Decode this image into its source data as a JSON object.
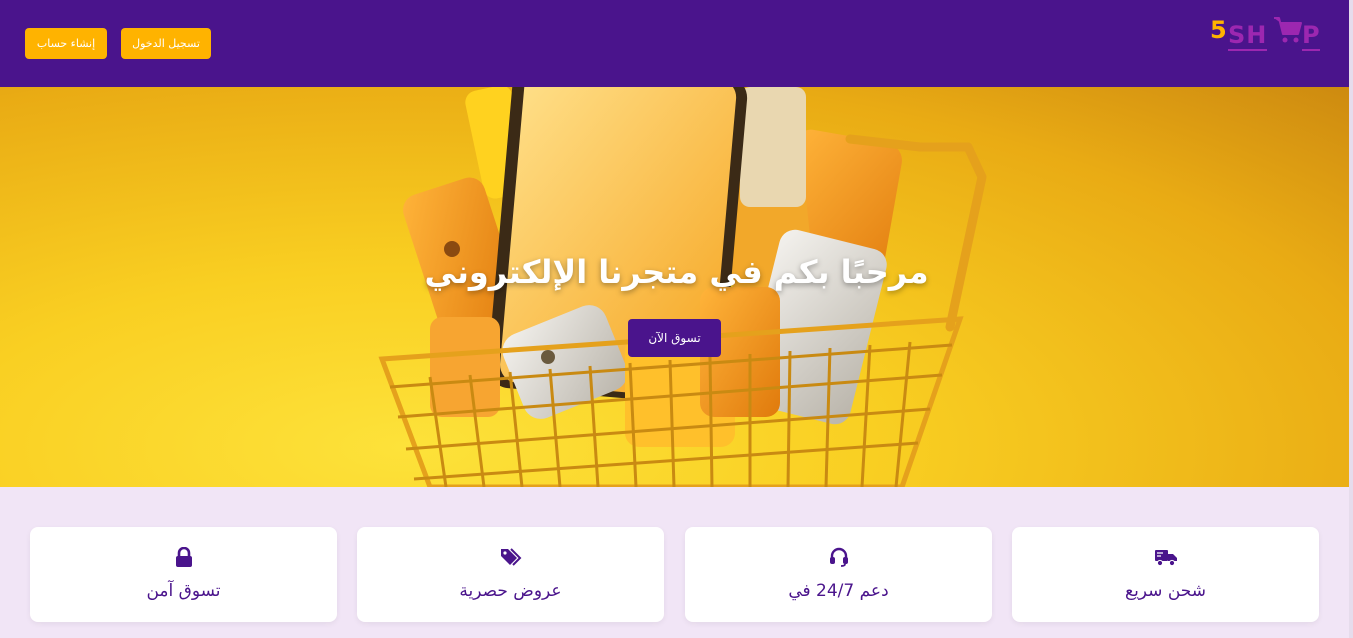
{
  "header": {
    "logo": {
      "number": "5",
      "text_part_1": "SH",
      "text_part_2": "P"
    },
    "signup_label": "إنشاء حساب",
    "login_label": "تسجيل الدخول"
  },
  "hero": {
    "title": "مرحبًا بكم في متجرنا الإلكتروني",
    "shop_button": "تسوق الآن"
  },
  "features": [
    {
      "icon": "lock-icon",
      "label": "تسوق آمن"
    },
    {
      "icon": "tags-icon",
      "label": "عروض حصرية"
    },
    {
      "icon": "headset-icon",
      "label": "دعم 24/7 في"
    },
    {
      "icon": "truck-icon",
      "label": "شحن سريع"
    }
  ],
  "colors": {
    "primary": "#4a148c",
    "accent": "#ffb300",
    "logo_purple": "#9c27b0",
    "page_bg": "#f1e5f6"
  }
}
